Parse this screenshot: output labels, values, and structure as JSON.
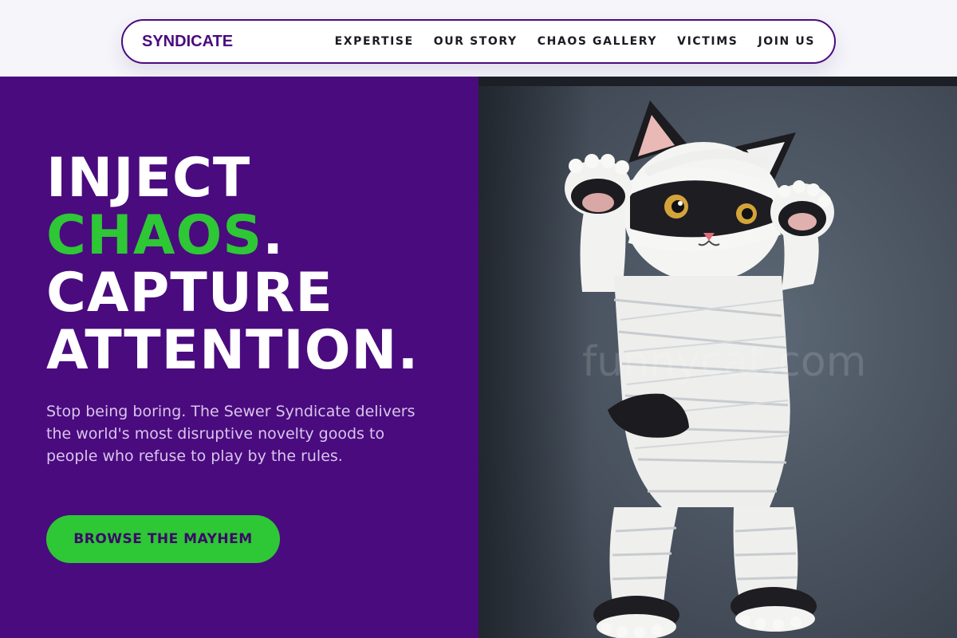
{
  "header": {
    "brand": "SYNDICATE",
    "nav": [
      {
        "label": "EXPERTISE"
      },
      {
        "label": "OUR STORY"
      },
      {
        "label": "CHAOS GALLERY"
      },
      {
        "label": "VICTIMS"
      },
      {
        "label": "JOIN US"
      }
    ]
  },
  "hero": {
    "headline_line1": "INJECT",
    "headline_accent": "CHAOS",
    "headline_dot": ".",
    "headline_line3": "CAPTURE",
    "headline_line4": "ATTENTION.",
    "subtext": "Stop being boring. The Sewer Syndicate delivers the world's most disruptive novelty goods to people who refuse to play by the rules.",
    "cta_label": "BROWSE THE MAYHEM",
    "image": {
      "subject": "mummy-wrapped cat figurine",
      "watermark": "funnycat.com"
    }
  },
  "colors": {
    "primary_purple": "#4a0b7e",
    "accent_green": "#2ec736",
    "nav_text": "#1b1b24",
    "subtext": "#d8c5ec"
  }
}
